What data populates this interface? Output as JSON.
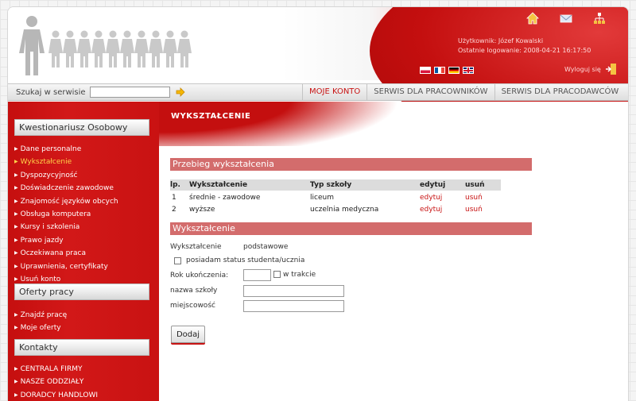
{
  "header": {
    "user_label": "Użytkownik: Józef Kowalski",
    "last_login": "Ostatnie logowanie: 2008-04-21 16:17:50",
    "logout": "Wyloguj się",
    "icons": [
      "home-icon",
      "mail-icon",
      "sitemap-icon"
    ],
    "flags": [
      "flag-pl",
      "flag-fr",
      "flag-de",
      "flag-gb"
    ]
  },
  "navbar": {
    "search_label": "Szukaj w serwisie",
    "search_value": "",
    "tabs": [
      {
        "label": "MOJE KONTO",
        "active": true
      },
      {
        "label": "SERWIS DLA PRACOWNIKÓW",
        "active": false
      },
      {
        "label": "SERWIS DLA PRACODAWCÓW",
        "active": false
      }
    ]
  },
  "sidebar": {
    "sections": [
      {
        "title": "Kwestionariusz Osobowy",
        "items": [
          "Dane personalne",
          "Wykształcenie",
          "Dyspozycyjność",
          "Doświadczenie zawodowe",
          "Znajomość języków obcych",
          "Obsługa komputera",
          "Kursy i szkolenia",
          "Prawo jazdy",
          "Oczekiwana praca",
          "Uprawnienia, certyfikaty",
          "Usuń konto"
        ],
        "active_item": "Wykształcenie"
      },
      {
        "title": "Oferty pracy",
        "items": [
          "Znajdź pracę",
          "Moje oferty"
        ]
      },
      {
        "title": "Kontakty",
        "items": [
          "CENTRALA FIRMY",
          "NASZE ODDZIAŁY",
          "DORADCY HANDLOWI"
        ]
      }
    ]
  },
  "content": {
    "title": "WYKSZTAŁCENIE",
    "history_title": "Przebieg wykształcenia",
    "table": {
      "headers": [
        "lp.",
        "Wykształcenie",
        "Typ szkoły",
        "edytuj",
        "usuń"
      ],
      "rows": [
        [
          "1",
          "średnie - zawodowe",
          "liceum",
          "edytuj",
          "usuń"
        ],
        [
          "2",
          "wyższe",
          "uczelnia medyczna",
          "edytuj",
          "usuń"
        ]
      ]
    },
    "form_title": "Wykształcenie",
    "form": {
      "education_label": "Wykształcenie",
      "education_value": "podstawowe",
      "student_status": "posiadam status studenta/ucznia",
      "year_label": "Rok ukończenia:",
      "in_progress": "w trakcie",
      "school_label": "nazwa szkoły",
      "city_label": "miejscowość",
      "year_value": "",
      "school_value": "",
      "city_value": ""
    },
    "submit": "Dodaj"
  },
  "colors": {
    "accent": "#c81414",
    "bar": "#d36c6c",
    "active_menu": "#ffd34a"
  }
}
